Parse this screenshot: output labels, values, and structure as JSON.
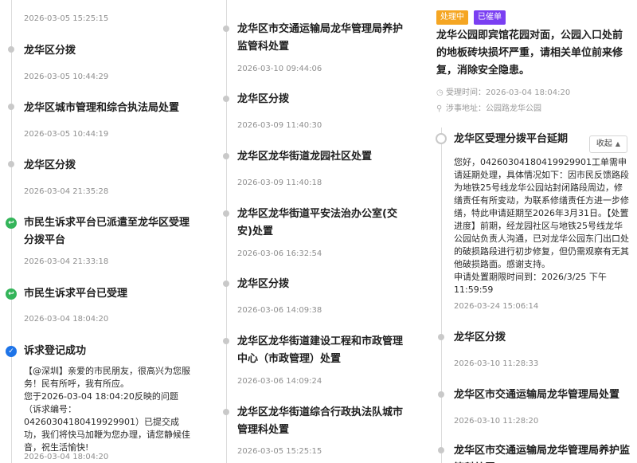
{
  "col1": {
    "top_time": "2026-03-05 15:25:15",
    "e1": {
      "title": "龙华区分拨",
      "time": "2026-03-05 10:44:29"
    },
    "e2": {
      "title": "龙华区城市管理和综合执法局处置",
      "time": "2026-03-05 10:44:19"
    },
    "e3": {
      "title": "龙华区分拨",
      "time": "2026-03-04 21:35:28"
    },
    "e4": {
      "title": "市民生诉求平台已派遣至龙华区受理分拨平台",
      "time": "2026-03-04 21:33:18"
    },
    "e5": {
      "title": "市民生诉求平台已受理",
      "time": "2026-03-04 18:04:20"
    },
    "e6": {
      "title": "诉求登记成功",
      "desc": "【@深圳】亲爱的市民朋友，很高兴为您服务！民有所呼，我有所应。\n您于2026-03-04 18:04:20反映的问题 （诉求编号：04260304180419929901）已提交成功，我们将快马加鞭为您办理，请您静候佳音，祝生活愉快!",
      "time": "2026-03-04 18:04:20"
    }
  },
  "col2": {
    "e1": {
      "title": "龙华区市交通运输局龙华管理局养护监管科处置",
      "time": "2026-03-10 09:44:06"
    },
    "e2": {
      "title": "龙华区分拨",
      "time": "2026-03-09 11:40:30"
    },
    "e3": {
      "title": "龙华区龙华街道龙园社区处置",
      "time": "2026-03-09 11:40:18"
    },
    "e4": {
      "title": "龙华区龙华街道平安法治办公室(交安)处置",
      "time": "2026-03-06 16:32:54"
    },
    "e5": {
      "title": "龙华区分拨",
      "time": "2026-03-06 14:09:38"
    },
    "e6": {
      "title": "龙华区龙华街道建设工程和市政管理中心（市政管理）处置",
      "time": "2026-03-06 14:09:24"
    },
    "e7": {
      "title": "龙华区龙华街道综合行政执法队城市管理科处置",
      "time": "2026-03-05 15:25:15"
    }
  },
  "col3": {
    "tag_status": "处理中",
    "tag_urged": "已催单",
    "issue": "龙华公园即宾馆花园对面，公园入口处前的地板砖块损坏严重，请相关单位前来修复，消除安全隐患。",
    "accept_time": "受理时间：2026-03-04 18:04:20",
    "address": "涉事地址：公园路龙华公园",
    "collapse_label": "收起",
    "e1": {
      "title": "龙华区受理分拨平台延期",
      "desc": "您好，04260304180419929901工单需申请延期处理，具体情况如下：因市民反馈路段为地铁25号线龙华公园站封闭路段周边，修缮责任有所变动，为联系修缮责任方进一步修缮，特此申请延期至2026年3月31日。【处置进度】前期，经龙园社区与地铁25号线龙华公园站负责人沟通，已对龙华公园东门出口处的破损路段进行初步修复，但仍需观察有无其他破损路面。感谢支持。\n申请处置期限时间到：2026/3/25 下午11:59:59",
      "time": "2026-03-24 15:06:14"
    },
    "e2": {
      "title": "龙华区分拨",
      "time": "2026-03-10 11:28:33"
    },
    "e3": {
      "title": "龙华区市交通运输局龙华管理局处置",
      "time": "2026-03-10 11:28:20"
    },
    "e4": {
      "title": "龙华区市交通运输局龙华管理局养护监管科处置"
    }
  },
  "colors": {
    "status_orange": "#f5a623",
    "urged_purple": "#7a3ff2",
    "success_green": "#34b55a",
    "registered_blue": "#1e74e8"
  },
  "icons": [
    "check-icon",
    "reply-icon",
    "clock-icon",
    "location-icon",
    "chevron-up-icon"
  ]
}
